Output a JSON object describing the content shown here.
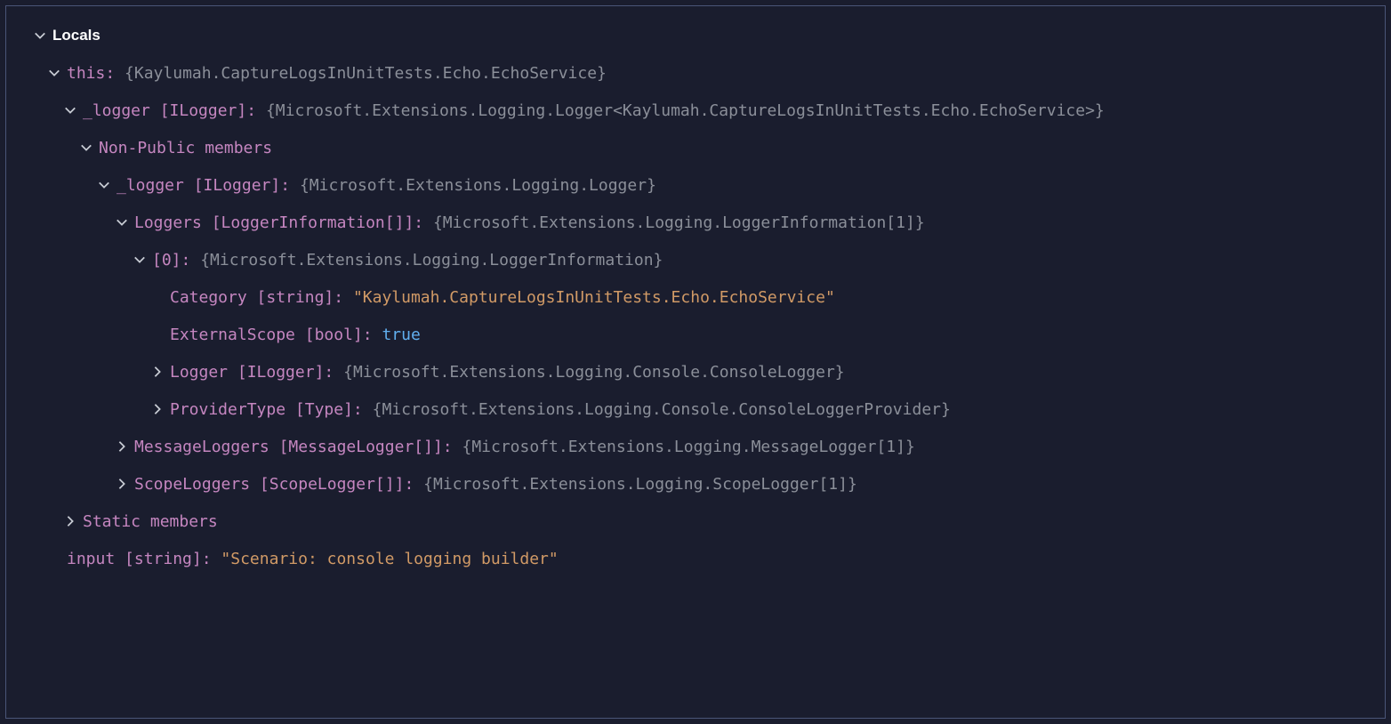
{
  "header": {
    "title": "Locals"
  },
  "rows": {
    "this": {
      "name": "this",
      "value": "{Kaylumah.CaptureLogsInUnitTests.Echo.EchoService}"
    },
    "logger1": {
      "name": "_logger",
      "type": "[ILogger]",
      "value": "{Microsoft.Extensions.Logging.Logger<Kaylumah.CaptureLogsInUnitTests.Echo.EchoService>}"
    },
    "nonPublic": {
      "name": "Non-Public members"
    },
    "logger2": {
      "name": "_logger",
      "type": "[ILogger]",
      "value": "{Microsoft.Extensions.Logging.Logger}"
    },
    "loggers": {
      "name": "Loggers",
      "type": "[LoggerInformation[]]",
      "value": "{Microsoft.Extensions.Logging.LoggerInformation[1]}"
    },
    "index0": {
      "name": "[0]",
      "value": "{Microsoft.Extensions.Logging.LoggerInformation}"
    },
    "category": {
      "name": "Category",
      "type": "[string]",
      "value": "\"Kaylumah.CaptureLogsInUnitTests.Echo.EchoService\""
    },
    "externalScope": {
      "name": "ExternalScope",
      "type": "[bool]",
      "value": "true"
    },
    "loggerConsole": {
      "name": "Logger",
      "type": "[ILogger]",
      "value": "{Microsoft.Extensions.Logging.Console.ConsoleLogger}"
    },
    "providerType": {
      "name": "ProviderType",
      "type": "[Type]",
      "value": "{Microsoft.Extensions.Logging.Console.ConsoleLoggerProvider}"
    },
    "messageLoggers": {
      "name": "MessageLoggers",
      "type": "[MessageLogger[]]",
      "value": "{Microsoft.Extensions.Logging.MessageLogger[1]}"
    },
    "scopeLoggers": {
      "name": "ScopeLoggers",
      "type": "[ScopeLogger[]]",
      "value": "{Microsoft.Extensions.Logging.ScopeLogger[1]}"
    },
    "staticMembers": {
      "name": "Static members"
    },
    "input": {
      "name": "input",
      "type": "[string]",
      "value": "\"Scenario: console logging builder\""
    }
  }
}
